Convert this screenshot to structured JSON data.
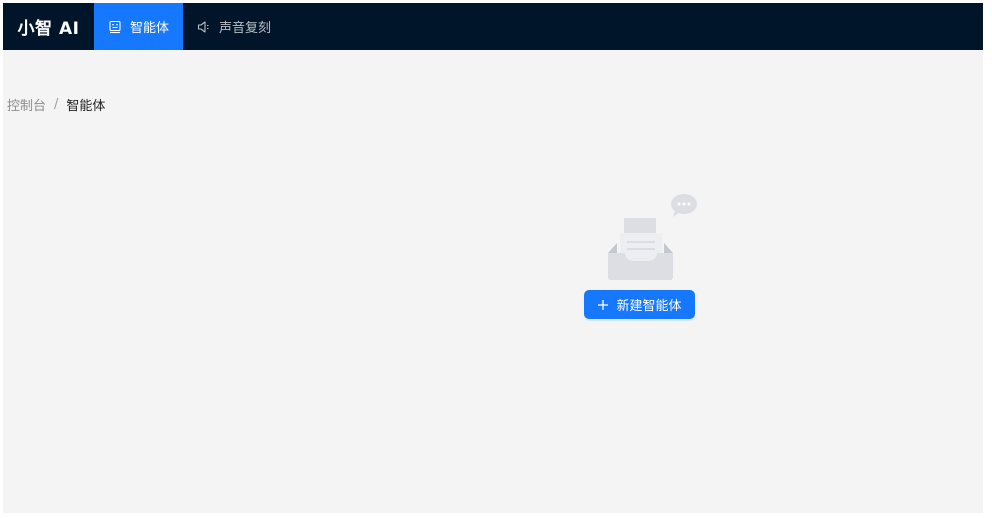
{
  "app": {
    "logo": "小智 AI"
  },
  "nav": {
    "items": [
      {
        "label": "智能体",
        "icon": "agent-icon",
        "active": true
      },
      {
        "label": "声音复刻",
        "icon": "sound-icon",
        "active": false
      }
    ]
  },
  "breadcrumb": {
    "root": "控制台",
    "separator": "/",
    "current": "智能体"
  },
  "empty_state": {
    "icon": "empty-inbox-icon",
    "button_label": "新建智能体",
    "button_icon": "plus-icon"
  },
  "colors": {
    "topbar": "#001529",
    "accent": "#1677ff",
    "content_bg": "#f4f4f5"
  }
}
